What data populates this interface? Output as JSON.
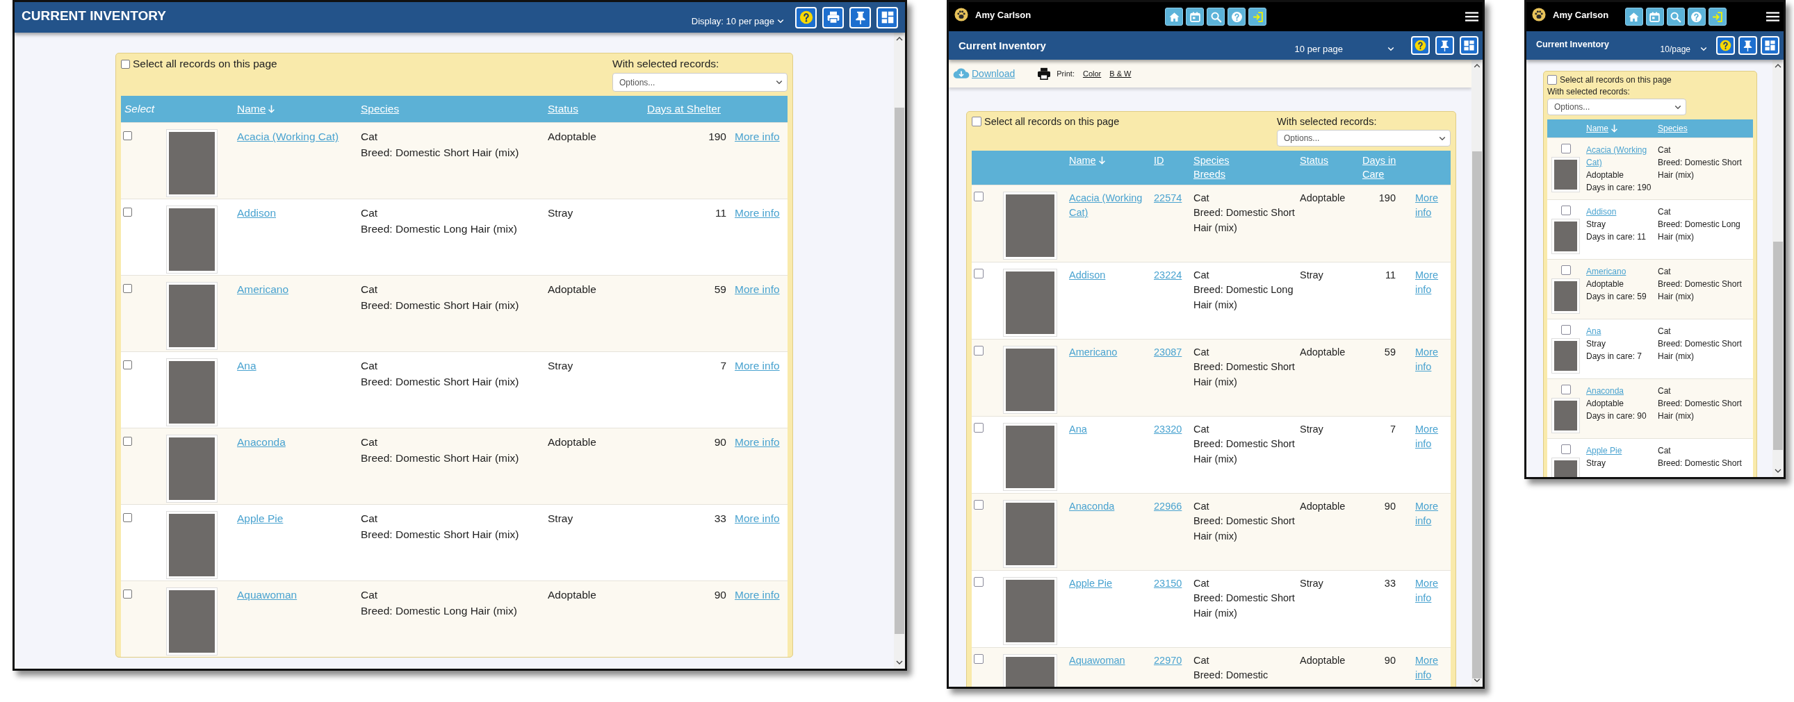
{
  "desktop": {
    "title": "CURRENT INVENTORY",
    "per_page": "Display: 10 per page",
    "select_all": {
      "label": "Select all records on this page",
      "checked": false
    },
    "with_selected": "With selected records:",
    "options": "Options...",
    "columns": [
      {
        "label": "Select",
        "sorted": false
      },
      {
        "label": "Name",
        "sorted": true
      },
      {
        "label": "Species",
        "sorted": false
      },
      {
        "label": "Status",
        "sorted": false
      },
      {
        "label": "Days at Shelter",
        "sorted": false
      }
    ],
    "rows": [
      {
        "checked": false,
        "name": "Acacia (Working Cat)",
        "species": "Cat",
        "breed": "Breed: Domestic Short Hair (mix)",
        "status": "Adoptable",
        "days": "190",
        "link": "More info"
      },
      {
        "checked": false,
        "name": "Addison",
        "species": "Cat",
        "breed": "Breed: Domestic Long Hair (mix)",
        "status": "Stray",
        "days": "11",
        "link": "More info"
      },
      {
        "checked": false,
        "name": "Americano",
        "species": "Cat",
        "breed": "Breed: Domestic Short Hair (mix)",
        "status": "Adoptable",
        "days": "59",
        "link": "More info"
      },
      {
        "checked": false,
        "name": "Ana",
        "species": "Cat",
        "breed": "Breed: Domestic Short Hair (mix)",
        "status": "Stray",
        "days": "7",
        "link": "More info"
      },
      {
        "checked": false,
        "name": "Anaconda",
        "species": "Cat",
        "breed": "Breed: Domestic Short Hair (mix)",
        "status": "Adoptable",
        "days": "90",
        "link": "More info"
      },
      {
        "checked": false,
        "name": "Apple Pie",
        "species": "Cat",
        "breed": "Breed: Domestic Short Hair (mix)",
        "status": "Stray",
        "days": "33",
        "link": "More info"
      },
      {
        "checked": false,
        "name": "Aquawoman",
        "species": "Cat",
        "breed": "Breed: Domestic Long Hair (mix)",
        "status": "Adoptable",
        "days": "90",
        "link": "More info"
      }
    ]
  },
  "tablet": {
    "user": "Amy Carlson",
    "title": "Current Inventory",
    "per_page": "10 per page",
    "download": "Download",
    "print_label": "Print:",
    "print_options": [
      "Color",
      "B & W"
    ],
    "select_all": {
      "label": "Select all records on this page",
      "checked": false
    },
    "with_selected": "With selected records:",
    "options": "Options...",
    "columns": [
      {
        "labels": [
          "Name"
        ],
        "sorted": true
      },
      {
        "labels": [
          "ID"
        ],
        "sorted": false
      },
      {
        "labels": [
          "Species",
          "Breeds"
        ],
        "sorted": false
      },
      {
        "labels": [
          "Status"
        ],
        "sorted": false
      },
      {
        "labels": [
          "Days in Care"
        ],
        "sorted": false
      }
    ],
    "rows": [
      {
        "checked": false,
        "name": "Acacia (Working Cat)",
        "id": "22574",
        "species": "Cat",
        "breed": "Breed: Domestic Short Hair (mix)",
        "status": "Adoptable",
        "days": "190",
        "link": "More info"
      },
      {
        "checked": false,
        "name": "Addison",
        "id": "23224",
        "species": "Cat",
        "breed": "Breed: Domestic Long Hair (mix)",
        "status": "Stray",
        "days": "11",
        "link": "More info"
      },
      {
        "checked": false,
        "name": "Americano",
        "id": "23087",
        "species": "Cat",
        "breed": "Breed: Domestic Short Hair (mix)",
        "status": "Adoptable",
        "days": "59",
        "link": "More info"
      },
      {
        "checked": false,
        "name": "Ana",
        "id": "23320",
        "species": "Cat",
        "breed": "Breed: Domestic Short Hair (mix)",
        "status": "Stray",
        "days": "7",
        "link": "More info"
      },
      {
        "checked": false,
        "name": "Anaconda",
        "id": "22966",
        "species": "Cat",
        "breed": "Breed: Domestic Short Hair (mix)",
        "status": "Adoptable",
        "days": "90",
        "link": "More info"
      },
      {
        "checked": false,
        "name": "Apple Pie",
        "id": "23150",
        "species": "Cat",
        "breed": "Breed: Domestic Short Hair (mix)",
        "status": "Stray",
        "days": "33",
        "link": "More info"
      },
      {
        "checked": false,
        "name": "Aquawoman",
        "id": "22970",
        "species": "Cat",
        "breed": "Breed: Domestic",
        "status": "Adoptable",
        "days": "90",
        "link": "More info"
      }
    ]
  },
  "phone": {
    "user": "Amy Carlson",
    "title": "Current Inventory",
    "per_page": "10/page",
    "select_all": {
      "label": "Select all records on this page",
      "checked": false
    },
    "with_selected": "With selected records:",
    "options": "Options...",
    "columns": [
      {
        "label": "Name",
        "sorted": true
      },
      {
        "label": "Species",
        "sorted": false
      }
    ],
    "rows": [
      {
        "checked": false,
        "name": "Acacia (Working Cat)",
        "status": "Adoptable",
        "days": "Days in care: 190",
        "species": "Cat",
        "breed": "Breed: Domestic Short Hair (mix)"
      },
      {
        "checked": false,
        "name": "Addison",
        "status": "Stray",
        "days": "Days in care: 11",
        "species": "Cat",
        "breed": "Breed: Domestic Long Hair (mix)"
      },
      {
        "checked": false,
        "name": "Americano",
        "status": "Adoptable",
        "days": "Days in care: 59",
        "species": "Cat",
        "breed": "Breed: Domestic Short Hair (mix)"
      },
      {
        "checked": false,
        "name": "Ana",
        "status": "Stray",
        "days": "Days in care: 7",
        "species": "Cat",
        "breed": "Breed: Domestic Short Hair (mix)"
      },
      {
        "checked": false,
        "name": "Anaconda",
        "status": "Adoptable",
        "days": "Days in care: 90",
        "species": "Cat",
        "breed": "Breed: Domestic Short Hair (mix)"
      },
      {
        "checked": false,
        "name": "Apple Pie",
        "status": "Stray",
        "species": "Cat",
        "breed": "Breed: Domestic Short"
      }
    ]
  }
}
